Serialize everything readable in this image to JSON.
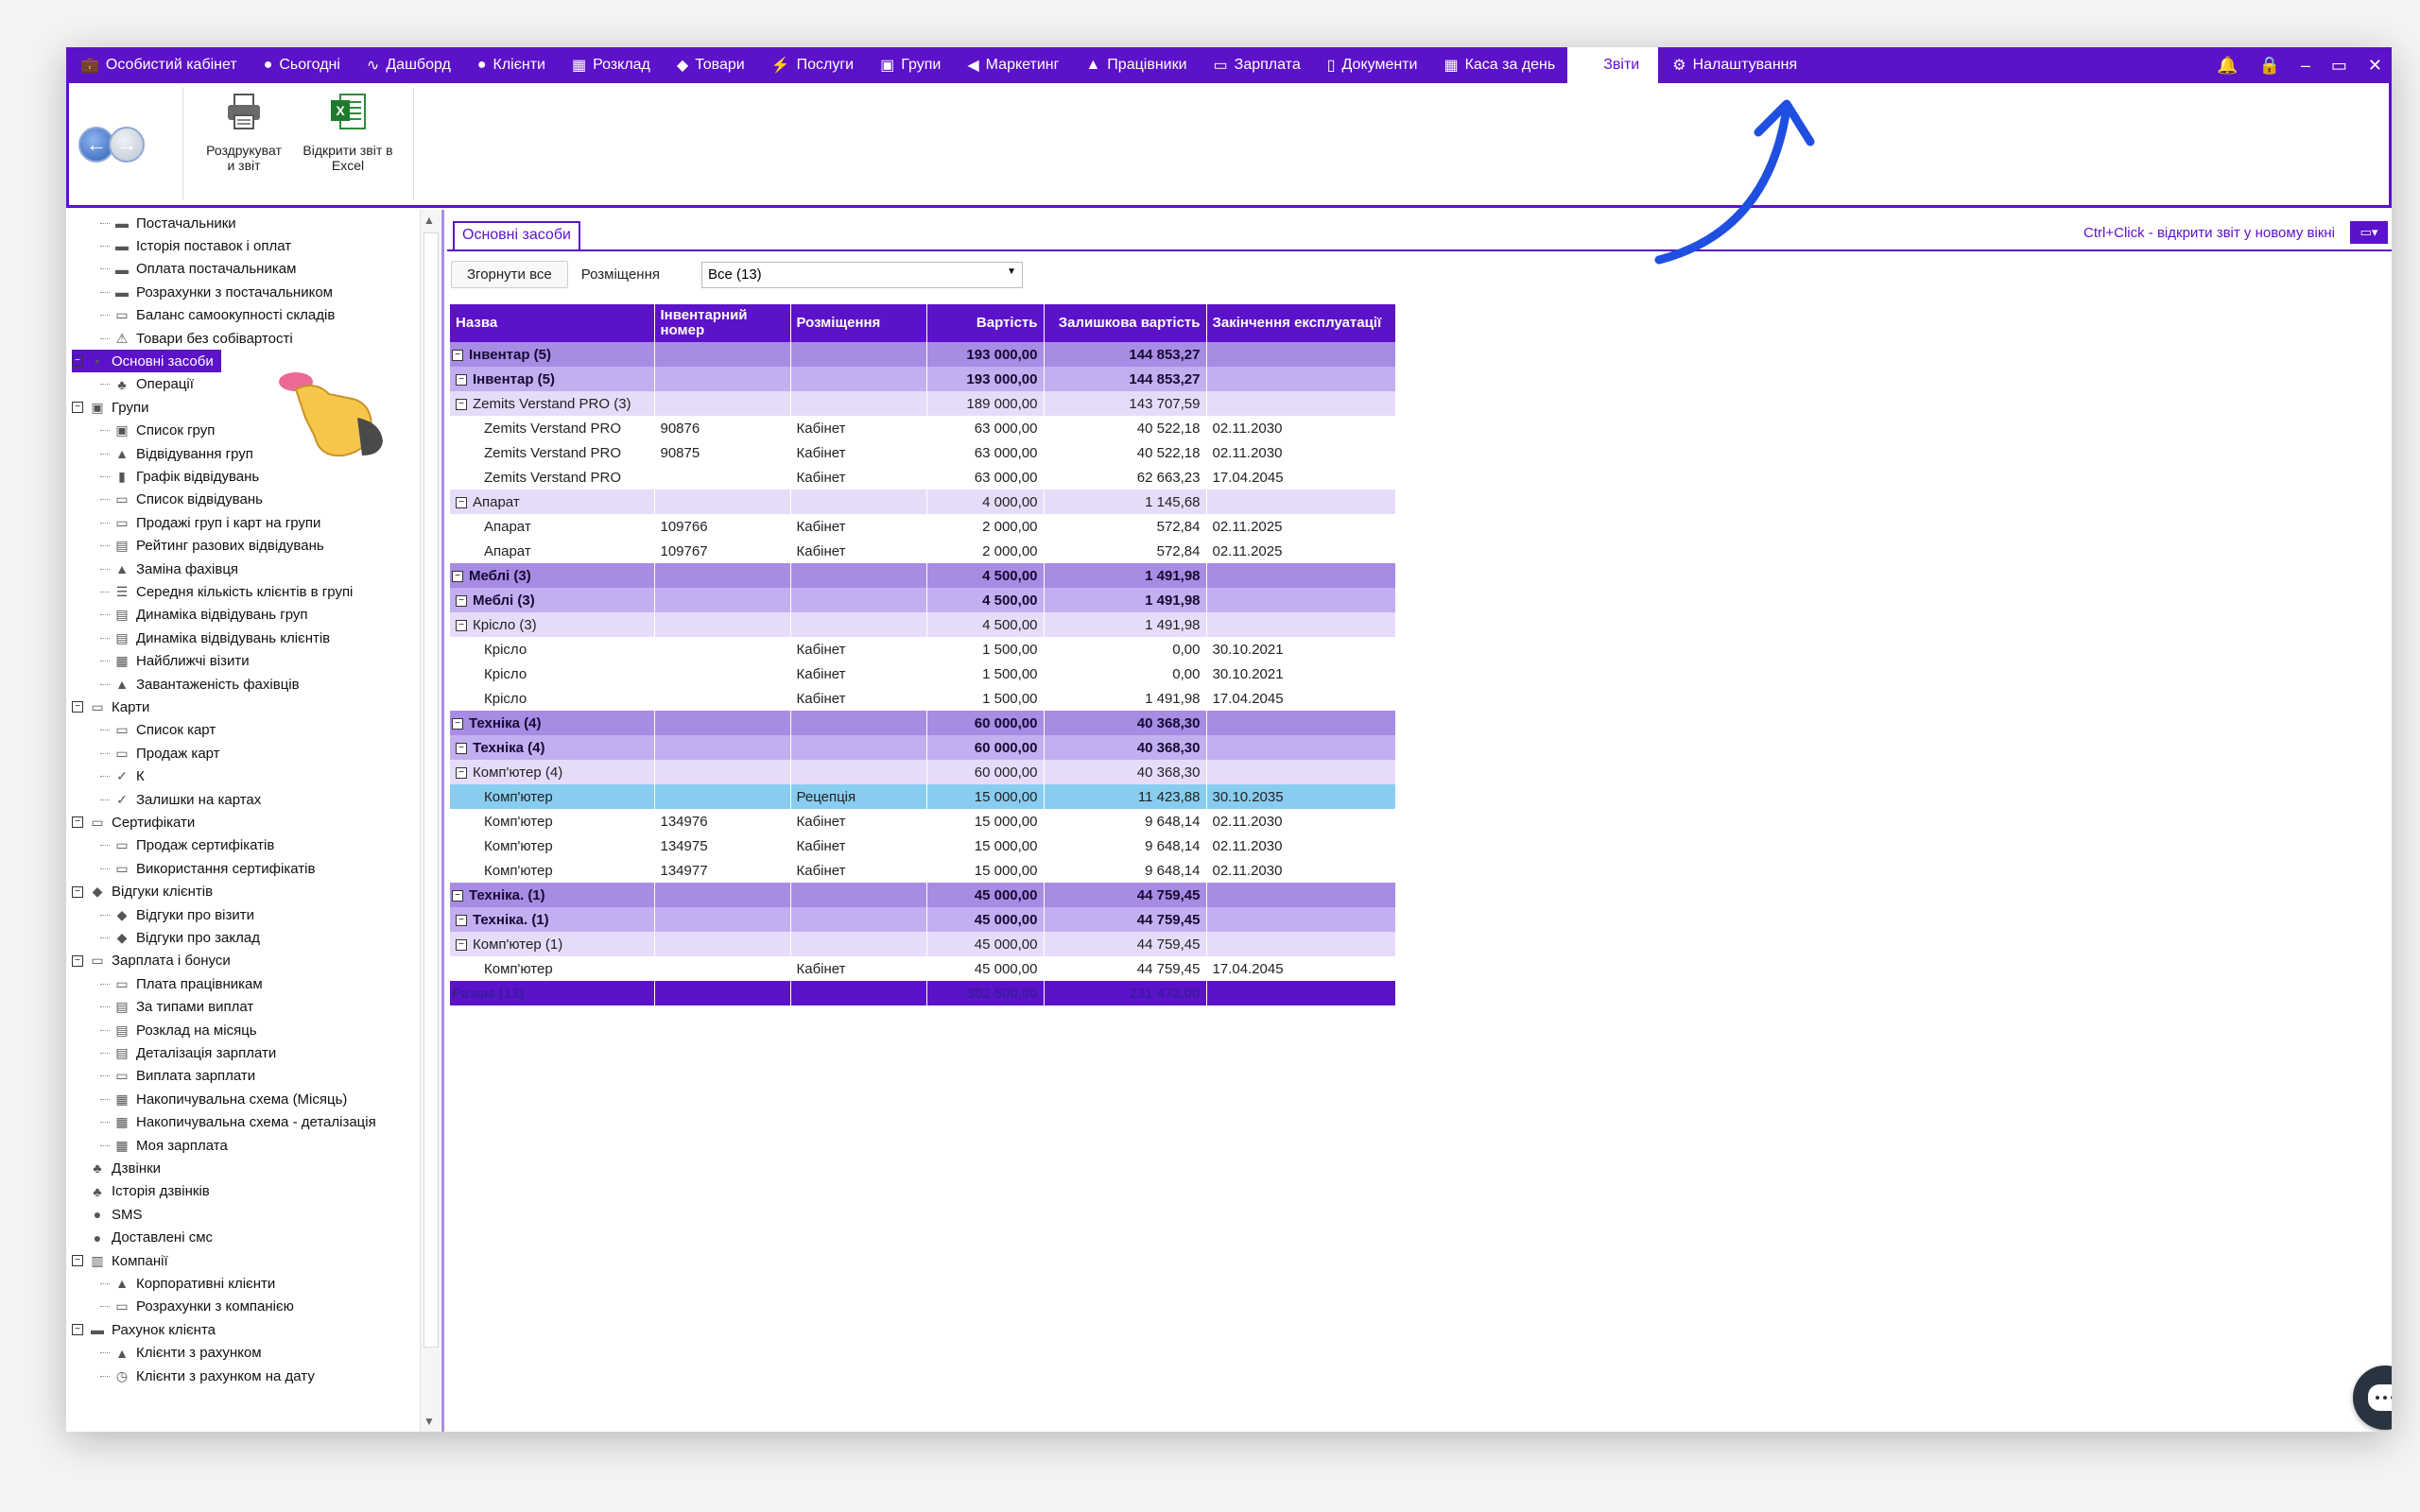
{
  "menu": {
    "items": [
      {
        "label": "Особистий кабінет",
        "icon": "briefcase-icon",
        "glyph": "💼"
      },
      {
        "label": "Сьогодні",
        "icon": "clock-icon",
        "glyph": "●"
      },
      {
        "label": "Дашборд",
        "icon": "pulse-icon",
        "glyph": "∿"
      },
      {
        "label": "Клієнти",
        "icon": "user-circle-icon",
        "glyph": "●"
      },
      {
        "label": "Розклад",
        "icon": "calendar-icon",
        "glyph": "▦"
      },
      {
        "label": "Товари",
        "icon": "cube-icon",
        "glyph": "◆"
      },
      {
        "label": "Послуги",
        "icon": "lightning-icon",
        "glyph": "⚡"
      },
      {
        "label": "Групи",
        "icon": "group-icon",
        "glyph": "▣"
      },
      {
        "label": "Маркетинг",
        "icon": "megaphone-icon",
        "glyph": "◀"
      },
      {
        "label": "Працівники",
        "icon": "person-icon",
        "glyph": "▲"
      },
      {
        "label": "Зарплата",
        "icon": "money-icon",
        "glyph": "▭"
      },
      {
        "label": "Документи",
        "icon": "document-icon",
        "glyph": "▯"
      },
      {
        "label": "Каса за день",
        "icon": "calculator-icon",
        "glyph": "▦"
      },
      {
        "label": "Звіти",
        "icon": "",
        "glyph": "",
        "active": true
      },
      {
        "label": "Налаштування",
        "icon": "gear-icon",
        "glyph": "⚙"
      }
    ],
    "right_icons": [
      "bell-icon",
      "lock-icon",
      "minimize-icon",
      "restore-icon",
      "close-icon"
    ],
    "right_glyphs": [
      "🔔",
      "🔒",
      "–",
      "▭",
      "✕"
    ]
  },
  "ribbon": {
    "print_label_1": "Роздрукуват",
    "print_label_2": "и звіт",
    "excel_label_1": "Відкрити звіт в",
    "excel_label_2": "Excel"
  },
  "sidebar": {
    "items": [
      {
        "label": "Постачальники",
        "level": 2,
        "icon": "truck-icon",
        "glyph": "▬"
      },
      {
        "label": "Історія поставок і оплат",
        "level": 2,
        "icon": "truck-icon",
        "glyph": "▬"
      },
      {
        "label": "Оплата постачальникам",
        "level": 2,
        "icon": "truck-icon",
        "glyph": "▬"
      },
      {
        "label": "Розрахунки з постачальником",
        "level": 2,
        "icon": "truck-icon",
        "glyph": "▬"
      },
      {
        "label": "Баланс самоокупності складів",
        "level": 2,
        "icon": "warehouse-icon",
        "glyph": "▭"
      },
      {
        "label": "Товари без собівартості",
        "level": 2,
        "icon": "warning-icon",
        "glyph": "⚠"
      },
      {
        "label": "Основні засоби",
        "level": 1,
        "icon": "assets-icon",
        "glyph": "▪",
        "selected": true,
        "box": "⊟"
      },
      {
        "label": "Операції",
        "level": 2,
        "icon": "operations-icon",
        "glyph": "♣"
      },
      {
        "label": "Групи",
        "level": 1,
        "icon": "group-icon",
        "glyph": "▣",
        "box": "⊟"
      },
      {
        "label": "Список груп",
        "level": 2,
        "icon": "list-icon",
        "glyph": "▣"
      },
      {
        "label": "Відвідування груп",
        "level": 2,
        "icon": "person-icon",
        "glyph": "▲"
      },
      {
        "label": "Графік відвідувань",
        "level": 2,
        "icon": "bar-chart-icon",
        "glyph": "▮"
      },
      {
        "label": "Список відвідувань",
        "level": 2,
        "icon": "ticket-icon",
        "glyph": "▭"
      },
      {
        "label": "Продажі груп і карт на групи",
        "level": 2,
        "icon": "ticket-icon",
        "glyph": "▭"
      },
      {
        "label": "Рейтинг разових відвідувань",
        "level": 2,
        "icon": "rating-icon",
        "glyph": "▤"
      },
      {
        "label": "Заміна фахівця",
        "level": 2,
        "icon": "person-icon",
        "glyph": "▲"
      },
      {
        "label": "Середня кількість клієнтів в групі",
        "level": 2,
        "icon": "list-icon",
        "glyph": "☰"
      },
      {
        "label": "Динаміка відвідувань груп",
        "level": 2,
        "icon": "table-icon",
        "glyph": "▤"
      },
      {
        "label": "Динаміка відвідувань клієнтів",
        "level": 2,
        "icon": "table-icon",
        "glyph": "▤"
      },
      {
        "label": "Найближчі візити",
        "level": 2,
        "icon": "calendar-icon",
        "glyph": "▦"
      },
      {
        "label": "Завантаженість фахівців",
        "level": 2,
        "icon": "person-icon",
        "glyph": "▲"
      },
      {
        "label": "Карти",
        "level": 1,
        "icon": "card-icon",
        "glyph": "▭",
        "box": "⊟"
      },
      {
        "label": "Список карт",
        "level": 2,
        "icon": "card-icon",
        "glyph": "▭"
      },
      {
        "label": "Продаж карт",
        "level": 2,
        "icon": "ticket-icon",
        "glyph": "▭"
      },
      {
        "label": "К",
        "level": 2,
        "icon": "card-check-icon",
        "glyph": "✓"
      },
      {
        "label": "Залишки на картах",
        "level": 2,
        "icon": "card-check-icon",
        "glyph": "✓"
      },
      {
        "label": "Сертифікати",
        "level": 1,
        "icon": "certificate-icon",
        "glyph": "▭",
        "box": "⊟"
      },
      {
        "label": "Продаж сертифікатів",
        "level": 2,
        "icon": "certificate-icon",
        "glyph": "▭"
      },
      {
        "label": "Використання сертифікатів",
        "level": 2,
        "icon": "certificate-icon",
        "glyph": "▭"
      },
      {
        "label": "Відгуки клієнтів",
        "level": 1,
        "icon": "feedback-icon",
        "glyph": "◆",
        "box": "⊟"
      },
      {
        "label": "Відгуки про візити",
        "level": 2,
        "icon": "feedback-icon",
        "glyph": "◆"
      },
      {
        "label": "Відгуки про заклад",
        "level": 2,
        "icon": "feedback-icon",
        "glyph": "◆"
      },
      {
        "label": "Зарплата і бонуси",
        "level": 1,
        "icon": "money-icon",
        "glyph": "▭",
        "box": "⊟"
      },
      {
        "label": "Плата працівникам",
        "level": 2,
        "icon": "money-icon",
        "glyph": "▭"
      },
      {
        "label": "За типами виплат",
        "level": 2,
        "icon": "table-icon",
        "glyph": "▤"
      },
      {
        "label": "Розклад на місяць",
        "level": 2,
        "icon": "table-icon",
        "glyph": "▤"
      },
      {
        "label": "Деталізація зарплати",
        "level": 2,
        "icon": "table-icon",
        "glyph": "▤"
      },
      {
        "label": "Виплата зарплати",
        "level": 2,
        "icon": "money-icon",
        "glyph": "▭"
      },
      {
        "label": "Накопичувальна схема (Місяць)",
        "level": 2,
        "icon": "calculator-icon",
        "glyph": "▦"
      },
      {
        "label": "Накопичувальна схема - деталізація",
        "level": 2,
        "icon": "calculator-icon",
        "glyph": "▦"
      },
      {
        "label": "Моя зарплата",
        "level": 2,
        "icon": "calculator-icon",
        "glyph": "▦"
      },
      {
        "label": "Дзвінки",
        "level": 1,
        "icon": "phone-icon",
        "glyph": "♣"
      },
      {
        "label": "Історія дзвінків",
        "level": 1,
        "icon": "phone-icon",
        "glyph": "♣"
      },
      {
        "label": "SMS",
        "level": 1,
        "icon": "chat-bubble-icon",
        "glyph": "●"
      },
      {
        "label": "Доставлені смс",
        "level": 1,
        "icon": "chat-bubble-icon",
        "glyph": "●"
      },
      {
        "label": "Компанії",
        "level": 1,
        "icon": "building-icon",
        "glyph": "▥",
        "box": "⊟"
      },
      {
        "label": "Корпоративні клієнти",
        "level": 2,
        "icon": "person-icon",
        "glyph": "▲"
      },
      {
        "label": "Розрахунки з компанією",
        "level": 2,
        "icon": "money-icon",
        "glyph": "▭"
      },
      {
        "label": "Рахунок клієнта",
        "level": 1,
        "icon": "wallet-icon",
        "glyph": "▬",
        "box": "⊟"
      },
      {
        "label": "Клієнти з рахунком",
        "level": 2,
        "icon": "person-icon",
        "glyph": "▲"
      },
      {
        "label": "Клієнти з рахунком на дату",
        "level": 2,
        "icon": "clock-icon",
        "glyph": "◷"
      }
    ]
  },
  "main": {
    "tab_label": "Основні засоби",
    "hint": "Ctrl+Click - відкрити звіт у новому вікні",
    "collapse_all": "Згорнути все",
    "placement_label": "Розміщення",
    "placement_value": "Все (13)"
  },
  "table": {
    "headers": [
      "Назва",
      "Інвентарний номер",
      "Розміщення",
      "Вартість",
      "Залишкова вартість",
      "Закінчення експлуатації"
    ],
    "rows": [
      {
        "type": "lvl1",
        "name": "Інвентар (5)",
        "inv": "",
        "place": "",
        "cost": "193 000,00",
        "residual": "144 853,27",
        "end": "",
        "exp": true,
        "indent": 0
      },
      {
        "type": "lvl2",
        "name": "Інвентар (5)",
        "inv": "",
        "place": "",
        "cost": "193 000,00",
        "residual": "144 853,27",
        "end": "",
        "exp": true,
        "indent": 1
      },
      {
        "type": "lvl3",
        "name": "Zemits Verstand PRO (3)",
        "inv": "",
        "place": "",
        "cost": "189 000,00",
        "residual": "143 707,59",
        "end": "",
        "exp": true,
        "indent": 1
      },
      {
        "type": "leaf",
        "name": "Zemits Verstand PRO",
        "inv": "90876",
        "place": "Кабінет",
        "cost": "63 000,00",
        "residual": "40 522,18",
        "end": "02.11.2030",
        "indent": 2
      },
      {
        "type": "leaf",
        "name": "Zemits Verstand PRO",
        "inv": "90875",
        "place": "Кабінет",
        "cost": "63 000,00",
        "residual": "40 522,18",
        "end": "02.11.2030",
        "indent": 2
      },
      {
        "type": "leaf",
        "name": "Zemits Verstand PRO",
        "inv": "",
        "place": "Кабінет",
        "cost": "63 000,00",
        "residual": "62 663,23",
        "end": "17.04.2045",
        "indent": 2
      },
      {
        "type": "lvl3",
        "name": "Апарат",
        "inv": "",
        "place": "",
        "cost": "4 000,00",
        "residual": "1 145,68",
        "end": "",
        "exp": true,
        "indent": 1
      },
      {
        "type": "leaf",
        "name": "Апарат",
        "inv": "109766",
        "place": "Кабінет",
        "cost": "2 000,00",
        "residual": "572,84",
        "end": "02.11.2025",
        "indent": 2
      },
      {
        "type": "leaf",
        "name": "Апарат",
        "inv": "109767",
        "place": "Кабінет",
        "cost": "2 000,00",
        "residual": "572,84",
        "end": "02.11.2025",
        "indent": 2
      },
      {
        "type": "lvl1",
        "name": "Меблі (3)",
        "inv": "",
        "place": "",
        "cost": "4 500,00",
        "residual": "1 491,98",
        "end": "",
        "exp": true,
        "indent": 0
      },
      {
        "type": "lvl2",
        "name": "Меблі (3)",
        "inv": "",
        "place": "",
        "cost": "4 500,00",
        "residual": "1 491,98",
        "end": "",
        "exp": true,
        "indent": 1
      },
      {
        "type": "lvl3",
        "name": "Крісло (3)",
        "inv": "",
        "place": "",
        "cost": "4 500,00",
        "residual": "1 491,98",
        "end": "",
        "exp": true,
        "indent": 1
      },
      {
        "type": "leaf",
        "name": "Крісло",
        "inv": "",
        "place": "Кабінет",
        "cost": "1 500,00",
        "residual": "0,00",
        "end": "30.10.2021",
        "indent": 2
      },
      {
        "type": "leaf",
        "name": "Крісло",
        "inv": "",
        "place": "Кабінет",
        "cost": "1 500,00",
        "residual": "0,00",
        "end": "30.10.2021",
        "indent": 2
      },
      {
        "type": "leaf",
        "name": "Крісло",
        "inv": "",
        "place": "Кабінет",
        "cost": "1 500,00",
        "residual": "1 491,98",
        "end": "17.04.2045",
        "indent": 2
      },
      {
        "type": "lvl1",
        "name": "Техніка (4)",
        "inv": "",
        "place": "",
        "cost": "60 000,00",
        "residual": "40 368,30",
        "end": "",
        "exp": true,
        "indent": 0
      },
      {
        "type": "lvl2",
        "name": "Техніка (4)",
        "inv": "",
        "place": "",
        "cost": "60 000,00",
        "residual": "40 368,30",
        "end": "",
        "exp": true,
        "indent": 1
      },
      {
        "type": "lvl3",
        "name": "Комп'ютер (4)",
        "inv": "",
        "place": "",
        "cost": "60 000,00",
        "residual": "40 368,30",
        "end": "",
        "exp": true,
        "indent": 1
      },
      {
        "type": "hl",
        "name": "Комп'ютер",
        "inv": "",
        "place": "Рецепція",
        "cost": "15 000,00",
        "residual": "11 423,88",
        "end": "30.10.2035",
        "indent": 2
      },
      {
        "type": "leaf",
        "name": "Комп'ютер",
        "inv": "134976",
        "place": "Кабінет",
        "cost": "15 000,00",
        "residual": "9 648,14",
        "end": "02.11.2030",
        "indent": 2
      },
      {
        "type": "leaf",
        "name": "Комп'ютер",
        "inv": "134975",
        "place": "Кабінет",
        "cost": "15 000,00",
        "residual": "9 648,14",
        "end": "02.11.2030",
        "indent": 2
      },
      {
        "type": "leaf",
        "name": "Комп'ютер",
        "inv": "134977",
        "place": "Кабінет",
        "cost": "15 000,00",
        "residual": "9 648,14",
        "end": "02.11.2030",
        "indent": 2
      },
      {
        "type": "lvl1",
        "name": "Техніка. (1)",
        "inv": "",
        "place": "",
        "cost": "45 000,00",
        "residual": "44 759,45",
        "end": "",
        "exp": true,
        "indent": 0
      },
      {
        "type": "lvl2",
        "name": "Техніка. (1)",
        "inv": "",
        "place": "",
        "cost": "45 000,00",
        "residual": "44 759,45",
        "end": "",
        "exp": true,
        "indent": 1
      },
      {
        "type": "lvl3",
        "name": "Комп'ютер (1)",
        "inv": "",
        "place": "",
        "cost": "45 000,00",
        "residual": "44 759,45",
        "end": "",
        "exp": true,
        "indent": 1
      },
      {
        "type": "leaf",
        "name": "Комп'ютер",
        "inv": "",
        "place": "Кабінет",
        "cost": "45 000,00",
        "residual": "44 759,45",
        "end": "17.04.2045",
        "indent": 2
      },
      {
        "type": "total",
        "name": "Разом (13)",
        "inv": "",
        "place": "",
        "cost": "302 500,00",
        "residual": "231 473,00",
        "end": "",
        "indent": 0
      }
    ]
  },
  "colors": {
    "accent": "#5b12c9",
    "row_lvl1": "#a88be3",
    "row_lvl2": "#c3aef0",
    "row_lvl3": "#e6dcfa",
    "row_highlight": "#88cdf0"
  }
}
